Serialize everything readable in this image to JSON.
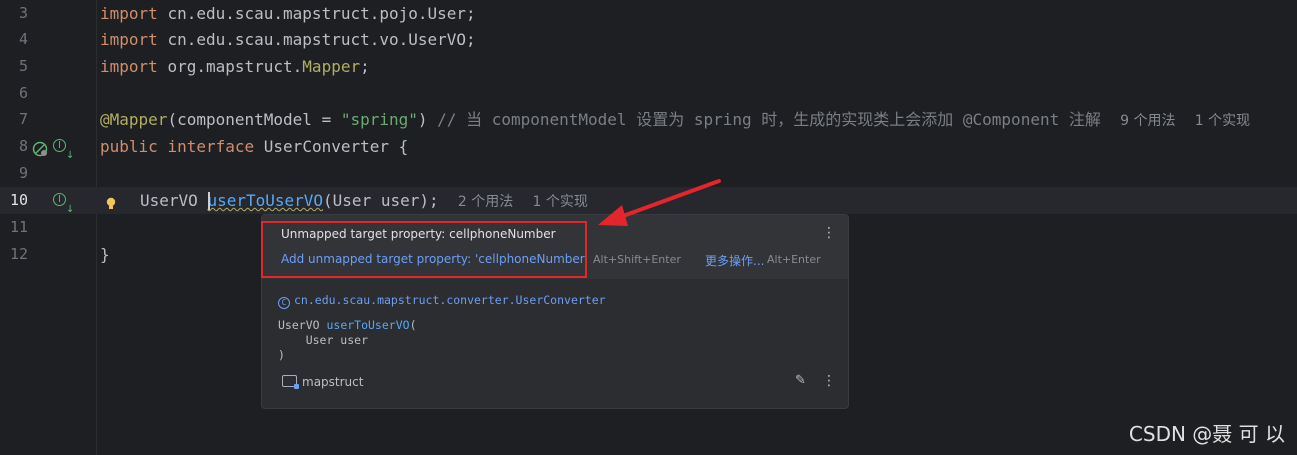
{
  "editor": {
    "lines": [
      {
        "num": "3",
        "import_kw": "import",
        "path": "cn.edu.scau.mapstruct.pojo.User;"
      },
      {
        "num": "4",
        "import_kw": "import",
        "path": "cn.edu.scau.mapstruct.vo.UserVO;"
      },
      {
        "num": "5",
        "import_kw": "import",
        "path_pre": "org.mapstruct.",
        "path_cls": "Mapper",
        "semi": ";"
      },
      {
        "num": "6"
      },
      {
        "num": "7",
        "annotation": "@Mapper",
        "args_open": "(componentModel = ",
        "str": "\"spring\"",
        "args_close": ")",
        "comment": "// 当 componentModel 设置为 spring 时，生成的实现类上会添加 @Component 注解",
        "hint_usages": "9 个用法",
        "hint_impl": "1 个实现"
      },
      {
        "num": "8",
        "kw_public": "public",
        "kw_interface": "interface",
        "name": "UserConverter {"
      },
      {
        "num": "9"
      },
      {
        "num": "10",
        "type": "UserVO",
        "method": "userToUserVO",
        "params": "(User user);",
        "hint_usages": "2 个用法",
        "hint_impl": "1 个实现"
      },
      {
        "num": "11"
      },
      {
        "num": "12",
        "brace": "}"
      }
    ]
  },
  "popup": {
    "problem_title": "Unmapped target property: cellphoneNumber",
    "fix_label": "Add unmapped target property: 'cellphoneNumber'",
    "fix_shortcut": "Alt+Shift+Enter",
    "more_actions_label": "更多操作...",
    "more_shortcut": "Alt+Enter",
    "class_icon": "C",
    "qualified_class": "cn.edu.scau.mapstruct.converter.UserConverter",
    "sig_type": "UserVO ",
    "sig_method": "userToUserVO",
    "sig_open": "(",
    "sig_param": "    User user",
    "sig_close": ")",
    "module": "mapstruct",
    "menu_icon": "⋮",
    "edit_icon": "✎"
  },
  "watermark": "CSDN @聂 可 以",
  "colors": {
    "highlight_box": "#e3262b",
    "arrow": "#e3262b",
    "link": "#6c9ef8"
  }
}
